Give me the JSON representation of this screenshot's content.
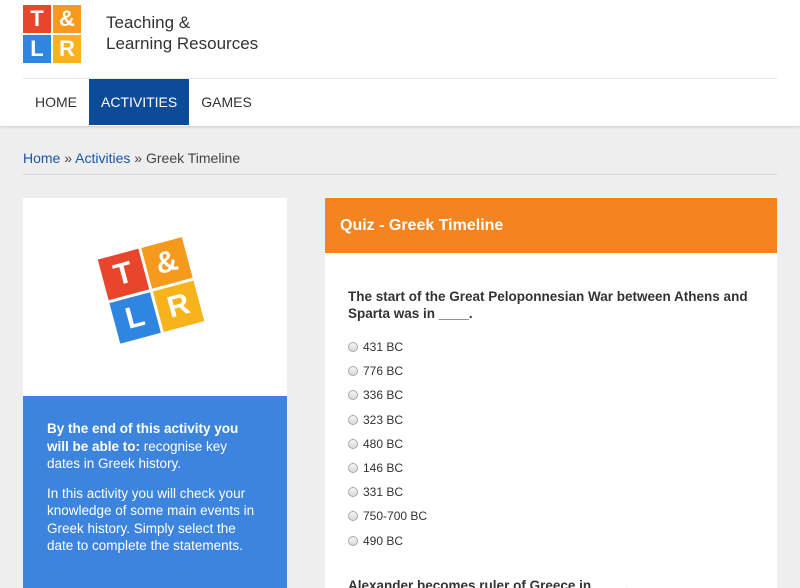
{
  "colors": {
    "nav_active": "#0d4a98",
    "quiz_header": "#f4841f",
    "info_box": "#3c84de",
    "tile_red": "#e8452c",
    "tile_orange": "#f59a1d",
    "tile_blue": "#2f86e0",
    "tile_yellow": "#f7b31c"
  },
  "logo": {
    "letters": [
      "T",
      "&",
      "L",
      "R"
    ]
  },
  "brand": {
    "line1": "Teaching &",
    "line2": "Learning Resources"
  },
  "nav": {
    "items": [
      "HOME",
      "ACTIVITIES",
      "GAMES"
    ],
    "active": "ACTIVITIES"
  },
  "breadcrumb": {
    "home": "Home",
    "sep": "»",
    "activities": "Activities",
    "current": "Greek Timeline"
  },
  "info": {
    "lead_bold": "By the end of this activity you will be able to:",
    "lead_rest": " recognise key dates in Greek history.",
    "body": "In this activity you will check your knowledge of some main events in Greek history. Simply select the date to complete the statements."
  },
  "quiz": {
    "title": "Quiz - Greek Timeline",
    "question1": "The start of the Great Peloponnesian War between Athens and Sparta was in ____.",
    "options": [
      "431 BC",
      "776 BC",
      "336 BC",
      "323 BC",
      "480 BC",
      "146 BC",
      "331 BC",
      "750-700 BC",
      "490 BC"
    ],
    "question2": "Alexander becomes ruler of Greece in ____."
  }
}
